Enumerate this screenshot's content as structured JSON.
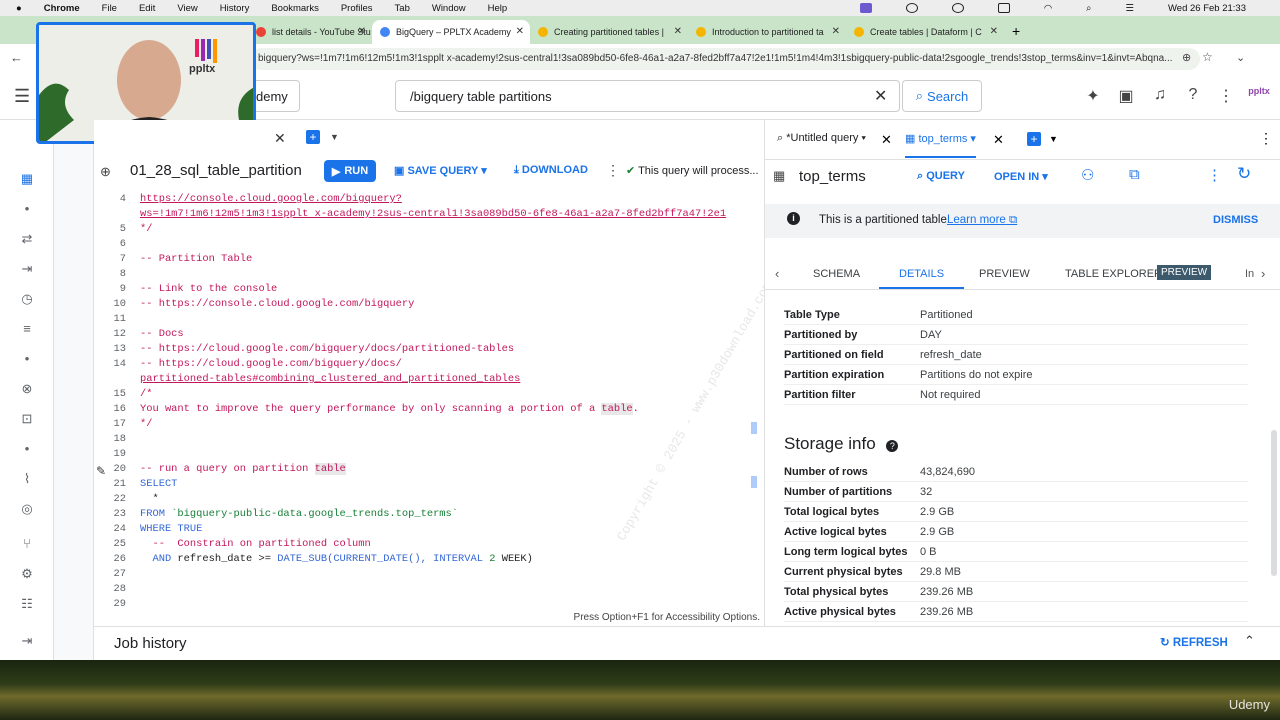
{
  "macbar": {
    "app": "Chrome",
    "menus": [
      "File",
      "Edit",
      "View",
      "History",
      "Bookmarks",
      "Profiles",
      "Tab",
      "Window",
      "Help"
    ],
    "datetime": "Wed 26 Feb 21:33"
  },
  "browser_tabs": [
    {
      "label": "list details - YouTube Stu",
      "color": "#ea4335"
    },
    {
      "label": "BigQuery – PPLTX Academy",
      "color": "#4285f4"
    },
    {
      "label": "Creating partitioned tables |",
      "color": "#f4b400"
    },
    {
      "label": "Introduction to partitioned ta",
      "color": "#f4b400"
    },
    {
      "label": "Create tables | Dataform | C",
      "color": "#f4b400"
    }
  ],
  "address": "bigquery?ws=!1m7!1m6!12m5!1m3!1spplt x-academy!2sus-central1!3sa089bd50-6fe8-46a1-a2a7-8fed2bff7a47!2e1!1m5!1m4!4m3!1sbigquery-public-data!2sgoogle_trends!3stop_terms&inv=1&invt=Abqna...",
  "header": {
    "project_label": "demy",
    "search_value": "/bigquery table partitions",
    "search_button": "Search",
    "logo_text": "ppltx"
  },
  "webcam": {
    "logo_text": "ppltx"
  },
  "editor": {
    "query_title": "01_28_sql_table_partition",
    "run_label": "RUN",
    "save_label": "SAVE QUERY",
    "download_label": "DOWNLOAD",
    "info_text": "This query will process...",
    "status_hint": "Press Option+F1 for Accessibility Options.",
    "watermark": "Copyright © 2025 - www.p30download.com"
  },
  "code_lines": [
    {
      "n": "4",
      "t": "https://console.cloud.google.com/bigquery?",
      "c": "url"
    },
    {
      "n": "",
      "t": "ws=!1m7!1m6!12m5!1m3!1spplt x-academy!2sus-central1!3sa089bd50-6fe8-46a1-a2a7-8fed2bff7a47!2e1",
      "c": "url"
    },
    {
      "n": "5",
      "t": "*/",
      "c": "cm"
    },
    {
      "n": "6",
      "t": "",
      "c": "cm"
    },
    {
      "n": "7",
      "t": "-- Partition Table",
      "c": "cm"
    },
    {
      "n": "8",
      "t": "",
      "c": "cm"
    },
    {
      "n": "9",
      "t": "-- Link to the console",
      "c": "cm"
    },
    {
      "n": "10",
      "t": "-- https://console.cloud.google.com/bigquery",
      "c": "cm"
    },
    {
      "n": "11",
      "t": "",
      "c": "cm"
    },
    {
      "n": "12",
      "t": "-- Docs",
      "c": "cm"
    },
    {
      "n": "13",
      "t": "-- https://cloud.google.com/bigquery/docs/partitioned-tables",
      "c": "cm"
    },
    {
      "n": "14",
      "t": "-- https://cloud.google.com/bigquery/docs/",
      "c": "cm"
    },
    {
      "n": "",
      "t": "partitioned-tables#combining_clustered_and_partitioned_tables",
      "c": "url"
    },
    {
      "n": "15",
      "t": "/*",
      "c": "cm"
    },
    {
      "n": "16",
      "t": "You want to improve the query performance by only scanning a portion of a table.",
      "c": "cm"
    },
    {
      "n": "17",
      "t": "*/",
      "c": "cm"
    },
    {
      "n": "18",
      "t": "",
      "c": "cm"
    },
    {
      "n": "19",
      "t": "",
      "c": "cm"
    },
    {
      "n": "20",
      "t": "-- run a query on partition table",
      "c": "cm"
    },
    {
      "n": "21",
      "t": "SELECT",
      "c": "kw"
    },
    {
      "n": "22",
      "t": "  *",
      "c": "plain"
    },
    {
      "n": "23",
      "t": "FROM `bigquery-public-data.google_trends.top_terms`",
      "c": "from"
    },
    {
      "n": "24",
      "t": "WHERE TRUE",
      "c": "kw"
    },
    {
      "n": "25",
      "t": "  --  Constrain on partitioned column",
      "c": "cm"
    },
    {
      "n": "26",
      "t": "  AND refresh_date >= DATE_SUB(CURRENT_DATE(), INTERVAL 2 WEEK)",
      "c": "and"
    },
    {
      "n": "27",
      "t": "",
      "c": "plain"
    },
    {
      "n": "28",
      "t": "",
      "c": "plain"
    },
    {
      "n": "29",
      "t": "",
      "c": "plain"
    }
  ],
  "right_panel": {
    "tab1": "*Untitled query",
    "tab2": "top_terms",
    "table_name": "top_terms",
    "query_btn": "QUERY",
    "open_in_btn": "OPEN IN",
    "banner_text": "This is a partitioned table.",
    "banner_link": "Learn more",
    "dismiss": "DISMISS",
    "detail_tabs": [
      "SCHEMA",
      "DETAILS",
      "PREVIEW",
      "TABLE EXPLORER"
    ],
    "preview_badge": "PREVIEW",
    "partition_rows": [
      {
        "k": "Table Type",
        "v": "Partitioned"
      },
      {
        "k": "Partitioned by",
        "v": "DAY"
      },
      {
        "k": "Partitioned on field",
        "v": "refresh_date"
      },
      {
        "k": "Partition expiration",
        "v": "Partitions do not expire"
      },
      {
        "k": "Partition filter",
        "v": "Not required"
      }
    ],
    "storage_title": "Storage info",
    "storage_rows": [
      {
        "k": "Number of rows",
        "v": "43,824,690"
      },
      {
        "k": "Number of partitions",
        "v": "32"
      },
      {
        "k": "Total logical bytes",
        "v": "2.9 GB"
      },
      {
        "k": "Active logical bytes",
        "v": "2.9 GB"
      },
      {
        "k": "Long term logical bytes",
        "v": "0 B"
      },
      {
        "k": "Current physical bytes",
        "v": "29.8 MB"
      },
      {
        "k": "Total physical bytes",
        "v": "239.26 MB"
      },
      {
        "k": "Active physical bytes",
        "v": "239.26 MB"
      }
    ]
  },
  "job_history": {
    "title": "Job history",
    "refresh": "REFRESH"
  },
  "udemy": "Udemy"
}
